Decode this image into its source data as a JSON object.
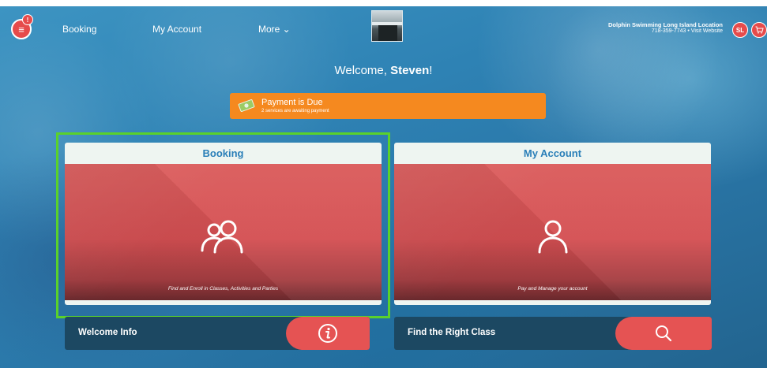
{
  "header": {
    "menu_badge": "!",
    "nav": [
      {
        "label": "Booking"
      },
      {
        "label": "My Account"
      },
      {
        "label": "More ⌄"
      }
    ],
    "location": {
      "name": "Dolphin Swimming Long Island Location",
      "sub": "718-359-7743 • Visit Website"
    },
    "avatar_initials": "SL"
  },
  "welcome": {
    "prefix": "Welcome, ",
    "name": "Steven",
    "suffix": "!"
  },
  "payment_banner": {
    "title": "Payment is Due",
    "subtitle": "2 services are awaiting payment",
    "color": "#f5891f"
  },
  "cards": {
    "booking": {
      "title": "Booking",
      "caption": "Find and Enroll in Classes, Activities and Parties"
    },
    "account": {
      "title": "My Account",
      "caption": "Pay and Manage your account"
    }
  },
  "bars": {
    "welcome_info": {
      "label": "Welcome Info"
    },
    "find_class": {
      "label": "Find the Right Class"
    }
  },
  "colors": {
    "accent_red": "#e55353",
    "highlight_green": "#5ad12b",
    "bar_navy": "#1c4862",
    "header_text": "#2a7fb8"
  }
}
